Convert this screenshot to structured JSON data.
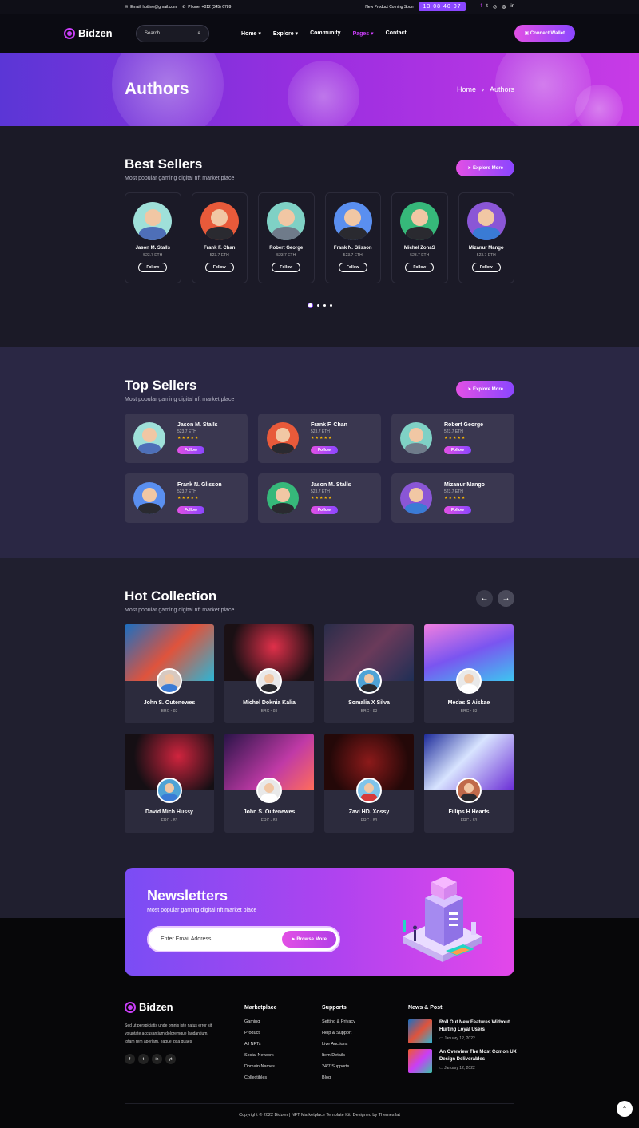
{
  "topbar": {
    "email": "Email: hotline@gmail.com",
    "phone": "Phone: +012 (345) 6789",
    "coming_soon": "New Product Coming Soon",
    "timer": "13 08 40 07",
    "socials": [
      "facebook-icon",
      "twitter-icon",
      "instagram-icon",
      "dribbble-icon",
      "linkedin-icon"
    ]
  },
  "nav": {
    "logo": "Bidzen",
    "search_placeholder": "Search...",
    "items": [
      "Home",
      "Explore",
      "Community",
      "Pages",
      "Contact"
    ],
    "active": "Pages",
    "wallet": "Connect Wallet"
  },
  "hero": {
    "title": "Authors",
    "crumb_home": "Home",
    "crumb_sep": "›",
    "crumb_current": "Authors"
  },
  "best": {
    "title": "Best Sellers",
    "subtitle": "Most popular gaming digital nft market place",
    "button": "Explore More",
    "cards": [
      {
        "name": "Jason M. Stalls",
        "eth": "523.7 ETH",
        "follow": "Follow",
        "bg": "#9fe0d9",
        "shirt": "#4e6fb8"
      },
      {
        "name": "Frank F. Chan",
        "eth": "523.7 ETH",
        "follow": "Follow",
        "bg": "#e85a3a",
        "shirt": "#2a2a30"
      },
      {
        "name": "Robert George",
        "eth": "523.7 ETH",
        "follow": "Follow",
        "bg": "#7fd1c5",
        "shirt": "#6f7b8a"
      },
      {
        "name": "Frank N. Glisson",
        "eth": "523.7 ETH",
        "follow": "Follow",
        "bg": "#5a8ff0",
        "shirt": "#2a2a30"
      },
      {
        "name": "Michel ZonaS",
        "eth": "523.7 ETH",
        "follow": "Follow",
        "bg": "#36b87a",
        "shirt": "#2a2a30"
      },
      {
        "name": "Mizanur Mango",
        "eth": "523.7 ETH",
        "follow": "Follow",
        "bg": "#8a56d6",
        "shirt": "#3a7bd5"
      }
    ]
  },
  "top": {
    "title": "Top Sellers",
    "subtitle": "Most popular gaming digital nft market place",
    "button": "Explore More",
    "cards": [
      {
        "name": "Jason M. Stalls",
        "eth": "523.7 ETH",
        "stars": "★★★★★",
        "follow": "Follow",
        "bg": "#9fe0d9",
        "shirt": "#4e6fb8"
      },
      {
        "name": "Frank F. Chan",
        "eth": "523.7 ETH",
        "stars": "★★★★★",
        "follow": "Follow",
        "bg": "#e85a3a",
        "shirt": "#2a2a30"
      },
      {
        "name": "Robert George",
        "eth": "523.7 ETH",
        "stars": "★★★★★",
        "follow": "Follow",
        "bg": "#7fd1c5",
        "shirt": "#6f7b8a"
      },
      {
        "name": "Frank N. Glisson",
        "eth": "523.7 ETH",
        "stars": "★★★★★",
        "follow": "Follow",
        "bg": "#5a8ff0",
        "shirt": "#2a2a30"
      },
      {
        "name": "Jason M. Stalls",
        "eth": "523.7 ETH",
        "stars": "★★★★★",
        "follow": "Follow",
        "bg": "#36b87a",
        "shirt": "#2a2a30"
      },
      {
        "name": "Mizanur Mango",
        "eth": "523.7 ETH",
        "stars": "★★★★★",
        "follow": "Follow",
        "bg": "#8a56d6",
        "shirt": "#3a7bd5"
      }
    ]
  },
  "hot": {
    "title": "Hot Collection",
    "subtitle": "Most popular gaming digital nft market place",
    "cards": [
      {
        "name": "John S. Outenewes",
        "erc": "ERC - 83",
        "img": "linear-gradient(135deg,#1a6fc2,#e0533c 50%,#2bb6d6)"
      },
      {
        "name": "Michel Doknia Kalia",
        "erc": "ERC - 83",
        "img": "radial-gradient(circle at 55% 40%,#e0304a,#1a1014 70%)"
      },
      {
        "name": "Somalia X Silva",
        "erc": "ERC - 83",
        "img": "linear-gradient(135deg,#2a2d4a,#6a3a5a 50%,#1f2f55)"
      },
      {
        "name": "Medas S Aiskae",
        "erc": "ERC - 83",
        "img": "linear-gradient(160deg,#f07ee0,#7a55f0 50%,#3dc6f0)"
      },
      {
        "name": "David Mich Hussy",
        "erc": "ERC - 83",
        "img": "radial-gradient(circle at 60% 40%,#d0243e,#150f14 70%)"
      },
      {
        "name": "John S. Outenewes",
        "erc": "ERC - 83",
        "img": "linear-gradient(135deg,#2a1448,#c03aa6 60%,#ff6d5a)"
      },
      {
        "name": "Zavi HD. Xossy",
        "erc": "ERC - 83",
        "img": "radial-gradient(circle at 50% 50%,#8c1a1a,#240808 75%)"
      },
      {
        "name": "Fillips H Hearts",
        "erc": "ERC - 83",
        "img": "linear-gradient(135deg,#1c2a9a,#d8e4ff 45%,#6a2dd6)"
      }
    ]
  },
  "newsletter": {
    "title": "Newsletters",
    "subtitle": "Most popular gaming digital nft market place",
    "placeholder": "Enter Email Address",
    "button": "Browse More"
  },
  "footer": {
    "logo": "Bidzen",
    "desc": "Sed ut perspiciatis unde omnis iste natus error sit voluptate accusantium doloremque laudantium, totam rem aperiam, eaque ipsa quaes",
    "socials": [
      "f",
      "t",
      "in",
      "yt"
    ],
    "marketplace_title": "Marketplace",
    "marketplace": [
      "Gaming",
      "Product",
      "All NFTs",
      "Social Network",
      "Domain Names",
      "Collectibles"
    ],
    "supports_title": "Supports",
    "supports": [
      "Setting & Privacy",
      "Help & Support",
      "Live Auctions",
      "Item Details",
      "24/7 Supports",
      "Blog"
    ],
    "news_title": "News & Post",
    "news": [
      {
        "title": "Roll Out New Features Without Hurting Loyal Users",
        "date": "January 12, 2022"
      },
      {
        "title": "An Overview The Most Comon UX Design Deliverables",
        "date": "January 12, 2022"
      }
    ],
    "copyright": "Copyright © 2022 Bidzen | NFT Marketplace Template Kit. Designed by Themesflat"
  }
}
